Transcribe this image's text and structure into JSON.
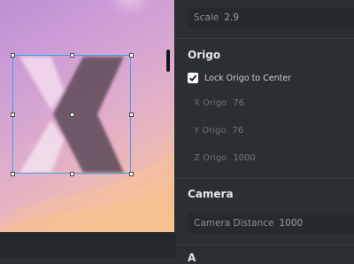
{
  "properties": {
    "scale": {
      "label": "Scale",
      "value": "2.9"
    },
    "origo": {
      "title": "Origo",
      "lock_label": "Lock Origo to Center",
      "lock_checked": true,
      "x": {
        "label": "X Origo",
        "value": "76"
      },
      "y": {
        "label": "Y Origo",
        "value": "76"
      },
      "z": {
        "label": "Z Origo",
        "value": "1000"
      }
    },
    "camera": {
      "title": "Camera",
      "distance": {
        "label": "Camera Distance",
        "value": "1000"
      }
    },
    "next_section_partial": "A"
  },
  "colors": {
    "selection": "#3aa0ea",
    "panel_bg": "#2b2e33",
    "canvas_gradient_start": "#bd8fd4",
    "canvas_gradient_end": "#f6c49a"
  }
}
